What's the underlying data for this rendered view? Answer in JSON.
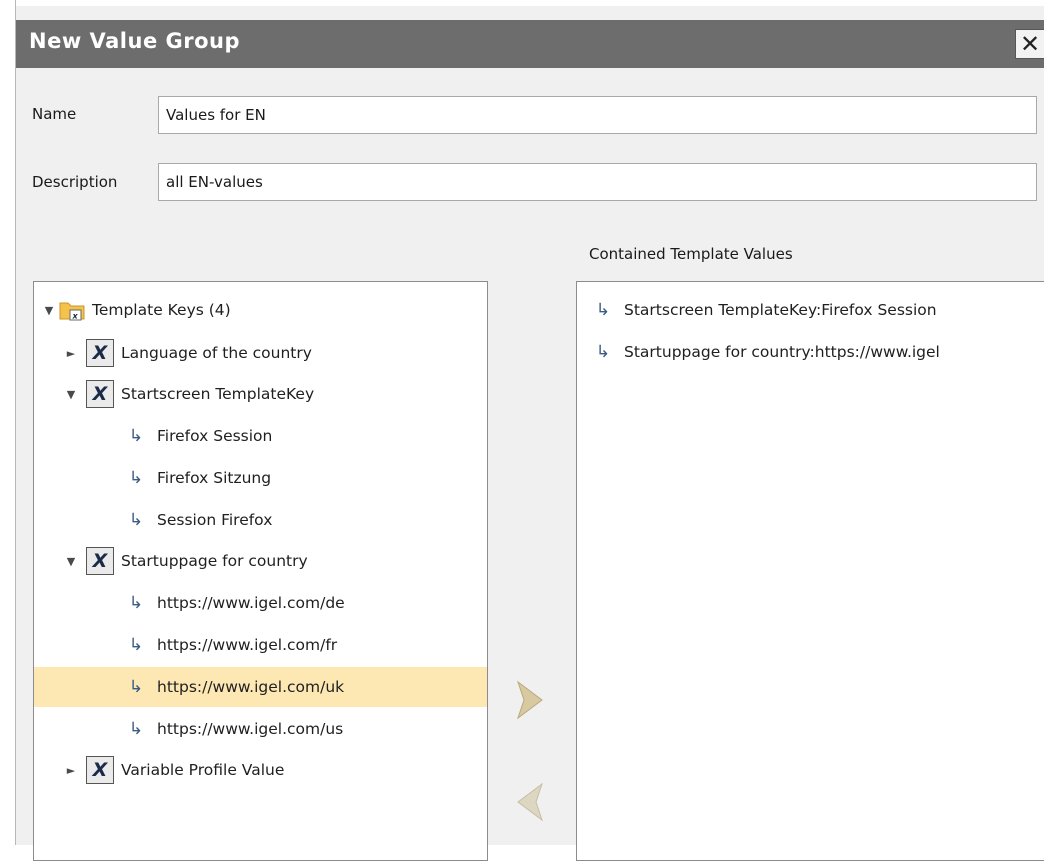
{
  "dialog": {
    "title": "New Value Group",
    "close_label": "✕"
  },
  "form": {
    "name_label": "Name",
    "name_value": "Values for EN",
    "description_label": "Description",
    "description_value": "all EN-values"
  },
  "right_panel": {
    "header": "Contained Template Values",
    "items": [
      "Startscreen TemplateKey:Firefox Session",
      "Startuppage for country:https://www.igel"
    ]
  },
  "tree": {
    "root": "Template Keys (4)",
    "keys": [
      {
        "label": "Language of the country",
        "expanded": false
      },
      {
        "label": "Startscreen TemplateKey",
        "expanded": true
      },
      {
        "label": "Startuppage for country",
        "expanded": true
      },
      {
        "label": "Variable Profile Value",
        "expanded": false
      }
    ],
    "startscreen_values": [
      "Firefox Session",
      "Firefox Sitzung",
      "Session Firefox"
    ],
    "startuppage_values": [
      "https://www.igel.com/de",
      "https://www.igel.com/fr",
      "https://www.igel.com/uk",
      "https://www.igel.com/us"
    ],
    "selected_value": "https://www.igel.com/uk"
  },
  "icons": {
    "expanded": "▼",
    "collapsed": "►",
    "template_key": "X",
    "value_arrow": "↳"
  },
  "colors": {
    "title_bar": "#6d6d6d",
    "selection": "#fde8b4",
    "move_button": "#d8c9a0"
  }
}
